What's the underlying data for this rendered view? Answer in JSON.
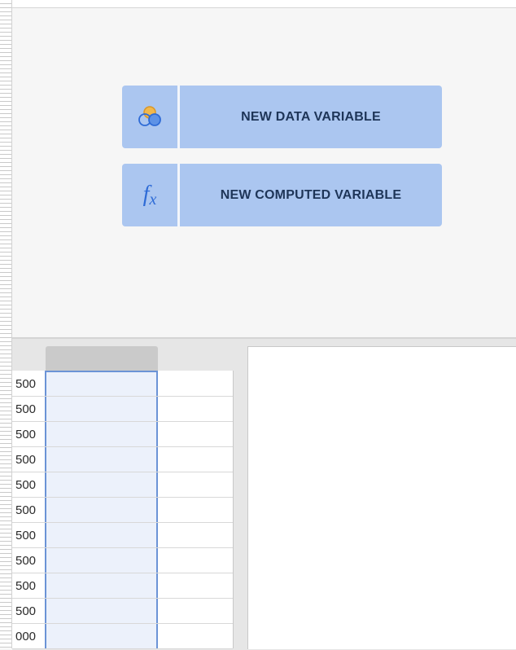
{
  "buttons": {
    "new_data_variable": "NEW DATA VARIABLE",
    "new_computed_variable": "NEW COMPUTED VARIABLE"
  },
  "icons": {
    "data_variable": "venn-circles-icon",
    "computed_variable": "fx-icon",
    "fx_main": "f",
    "fx_sub": "x"
  },
  "colors": {
    "button_bg": "#abc6f0",
    "accent": "#2e6bd6",
    "selected_column_border": "#6b93d6"
  },
  "grid": {
    "rows": [
      "500",
      "500",
      "500",
      "500",
      "500",
      "500",
      "500",
      "500",
      "500",
      "500",
      "000"
    ]
  }
}
